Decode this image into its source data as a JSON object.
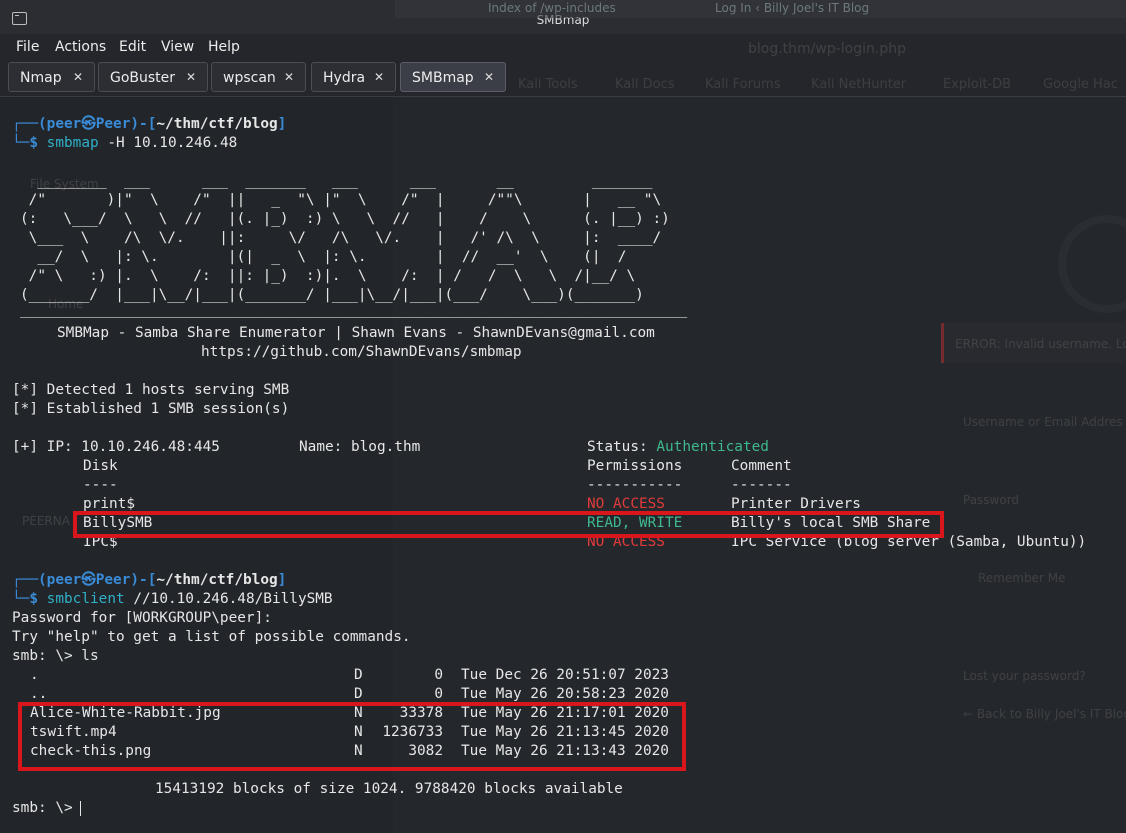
{
  "window": {
    "title": "SMBmap"
  },
  "background_tabs": [
    "Index of /wp-includes",
    "Log In ‹ Billy Joel's IT Blog"
  ],
  "background_browser": {
    "url": "blog.thm/wp-login.php",
    "bookmarks": [
      "Kali Tools",
      "Kali Docs",
      "Kali Forums",
      "Kali NetHunter",
      "Exploit-DB",
      "Google Hac"
    ],
    "error_text": "ERROR: Invalid username. Lo",
    "username_label": "Username or Email Addres",
    "password_label": "Password",
    "remember_label": "Remember Me",
    "lost_password": "Lost your password?",
    "back_link": "← Back to Billy Joel's IT Blog"
  },
  "desktop_icons": [
    "File System",
    "Home",
    "PEERNA"
  ],
  "menu": [
    "File",
    "Actions",
    "Edit",
    "View",
    "Help"
  ],
  "tabs": [
    {
      "label": "Nmap"
    },
    {
      "label": "GoBuster"
    },
    {
      "label": "wpscan"
    },
    {
      "label": "Hydra"
    },
    {
      "label": "SMBmap"
    }
  ],
  "prompt": {
    "open": "┌──(",
    "user": "peer",
    "at": "㉿",
    "host": "Peer",
    "mid": ")-[",
    "path": "~/thm/ctf/blog",
    "close": "]",
    "corner": "└─",
    "dollar": "$"
  },
  "cmd1": {
    "name": "smbmap",
    "args": "-H 10.10.246.48"
  },
  "banner": [
    "  ________  ___      ___  _______   ___      ___       __         _______",
    " /\"       )|\"  \\    /\"  ||   _  \"\\ |\"  \\    /\"  |     /\"\"\\       |   __ \"\\",
    "(:   \\___/  \\   \\  //   |(. |_)  :) \\   \\  //   |    /    \\      (. |__) :)",
    " \\___  \\    /\\  \\/.    ||:     \\/   /\\   \\/.    |   /' /\\  \\     |:  ____/",
    "  __/  \\   |: \\.        |(|  _  \\  |: \\.        |  //  __'  \\    (|  /",
    " /\" \\   :) |.  \\    /:  ||: |_)  :)|.  \\    /:  | /   /  \\   \\  /|__/ \\",
    "(_______/  |___|\\__/|___|(_______/ |___|\\__/|___|(___/    \\___)(_______)"
  ],
  "separator": "_____________________________________________________________________________",
  "subtitle": "SMBMap - Samba Share Enumerator | Shawn Evans - ShawnDEvans@gmail.com",
  "url": "https://github.com/ShawnDEvans/smbmap",
  "detect1": "[*] Detected 1 hosts serving SMB",
  "detect2": "[*] Established 1 SMB session(s)",
  "ipline": {
    "prefix": "[+] IP: 10.10.246.48:445",
    "name": "Name: blog.thm",
    "status_label": "Status:",
    "status_value": "Authenticated"
  },
  "share_headers": {
    "disk": "Disk",
    "perms": "Permissions",
    "comment": "Comment",
    "disk_ul": "----",
    "perms_ul": "-----------",
    "comment_ul": "-------"
  },
  "shares": [
    {
      "disk": "print$",
      "perm": "NO ACCESS",
      "comment": "Printer Drivers"
    },
    {
      "disk": "BillySMB",
      "perm": "READ, WRITE",
      "comment": "Billy's local SMB Share"
    },
    {
      "disk": "IPC$",
      "perm": "NO ACCESS",
      "comment": "IPC Service (blog server (Samba, Ubuntu))"
    }
  ],
  "cmd2": {
    "name": "smbclient",
    "args": "//10.10.246.48/BillySMB"
  },
  "password_line": "Password for [WORKGROUP\\peer]:",
  "help_line": "Try \"help\" to get a list of possible commands.",
  "smb_ls": "smb: \\> ls",
  "files": [
    {
      "name": ".",
      "type": "D",
      "size": "0",
      "date": "Tue Dec 26 20:51:07 2023"
    },
    {
      "name": "..",
      "type": "D",
      "size": "0",
      "date": "Tue May 26 20:58:23 2020"
    },
    {
      "name": "Alice-White-Rabbit.jpg",
      "type": "N",
      "size": "33378",
      "date": "Tue May 26 21:17:01 2020"
    },
    {
      "name": "tswift.mp4",
      "type": "N",
      "size": "1236733",
      "date": "Tue May 26 21:13:45 2020"
    },
    {
      "name": "check-this.png",
      "type": "N",
      "size": "3082",
      "date": "Tue May 26 21:13:43 2020"
    }
  ],
  "blocks_line": "15413192 blocks of size 1024. 9788420 blocks available",
  "smb_prompt": "smb: \\>",
  "colors": {
    "highlight_box": "#d8161c",
    "prompt_blue": "#3a8bd6",
    "status_green": "#3fb88d",
    "no_access_red": "#e03b3b",
    "command_cyan": "#2fb0c8"
  }
}
